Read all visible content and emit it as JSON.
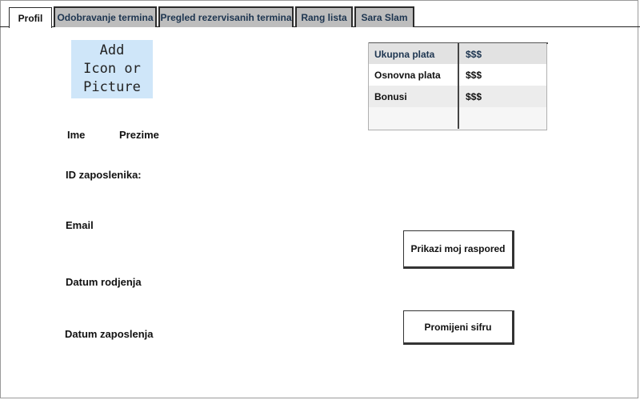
{
  "tabs": [
    {
      "label": "Profil",
      "active": true
    },
    {
      "label": "Odobravanje termina",
      "active": false
    },
    {
      "label": "Pregled rezervisanih termina",
      "active": false
    },
    {
      "label": "Rang lista",
      "active": false
    },
    {
      "label": "Sara Slam",
      "active": false
    }
  ],
  "profile": {
    "avatar_placeholder": "Add\nIcon or\nPicture",
    "first_name_label": "Ime",
    "last_name_label": "Prezime",
    "employee_id_label": "ID zaposlenika:",
    "email_label": "Email",
    "birth_date_label": "Datum rodjenja",
    "employment_date_label": "Datum zaposlenja"
  },
  "salary": {
    "header": {
      "label": "Ukupna plata",
      "value": "$$$"
    },
    "rows": [
      {
        "label": "Osnovna plata",
        "value": "$$$"
      },
      {
        "label": "Bonusi",
        "value": "$$$"
      },
      {
        "label": "",
        "value": ""
      }
    ]
  },
  "actions": {
    "show_schedule_label": "Prikazi moj raspored",
    "change_password_label": "Promijeni sifru"
  },
  "colors": {
    "tab_inactive_bg": "#bdbdbd",
    "tab_text": "#1d3550",
    "avatar_bg": "#cfe6f9"
  }
}
